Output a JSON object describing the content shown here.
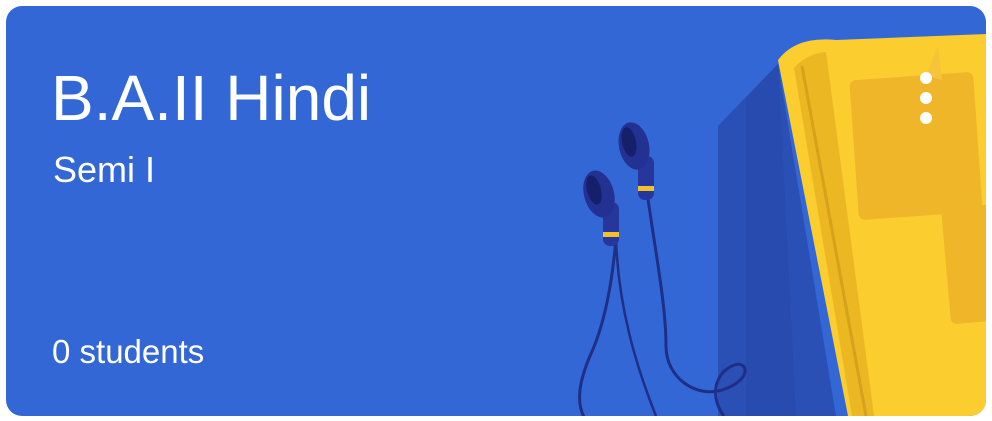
{
  "class_card": {
    "title": "B.A.II Hindi",
    "section": "Semi I",
    "students_count": "0 students",
    "menu_icon": "more-vert-icon",
    "illustration_icon": "earphones-notebook-illustration",
    "colors": {
      "card_background": "#3367d6",
      "notebook_yellow": "#fbcd2f",
      "text": "#ffffff"
    }
  }
}
